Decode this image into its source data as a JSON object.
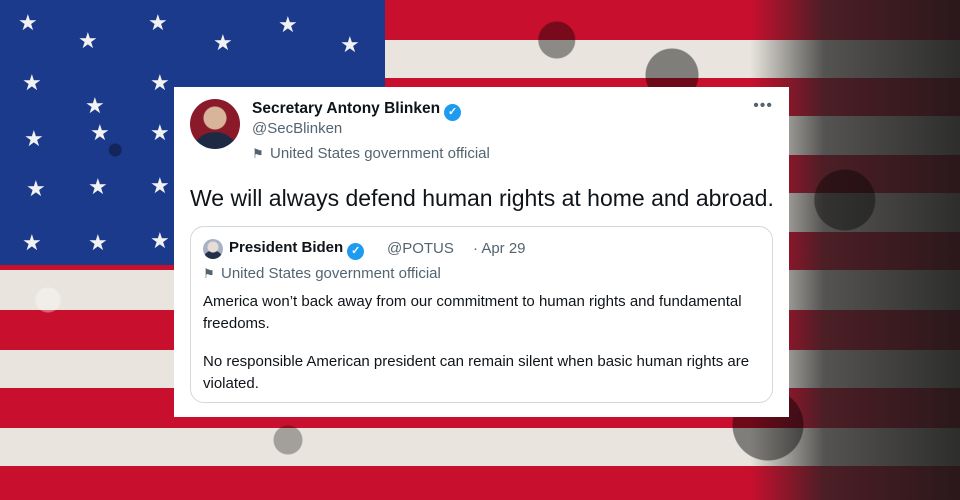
{
  "colors": {
    "flag_red": "#c8102e",
    "flag_blue": "#1b3a8c",
    "flag_white": "#e9e5de",
    "verified_blue": "#1d9bf0",
    "muted_text": "#536471",
    "primary_text": "#0f1419"
  },
  "tweet": {
    "author_name": "Secretary Antony Blinken",
    "handle": "@SecBlinken",
    "label": "United States government official",
    "more_icon": "more-options-icon",
    "text": "We will always defend human rights at home and abroad."
  },
  "quoted_tweet": {
    "author_name": "President Biden",
    "handle": "@POTUS",
    "date": "· Apr 29",
    "label": "United States government official",
    "paragraph_1": "America won’t back away from our commitment to human rights and fundamental freedoms.",
    "paragraph_2": "No responsible American president can remain silent when basic human rights are violated."
  },
  "icons": {
    "verified": "verified-badge-icon",
    "government_label": "flag-icon"
  }
}
